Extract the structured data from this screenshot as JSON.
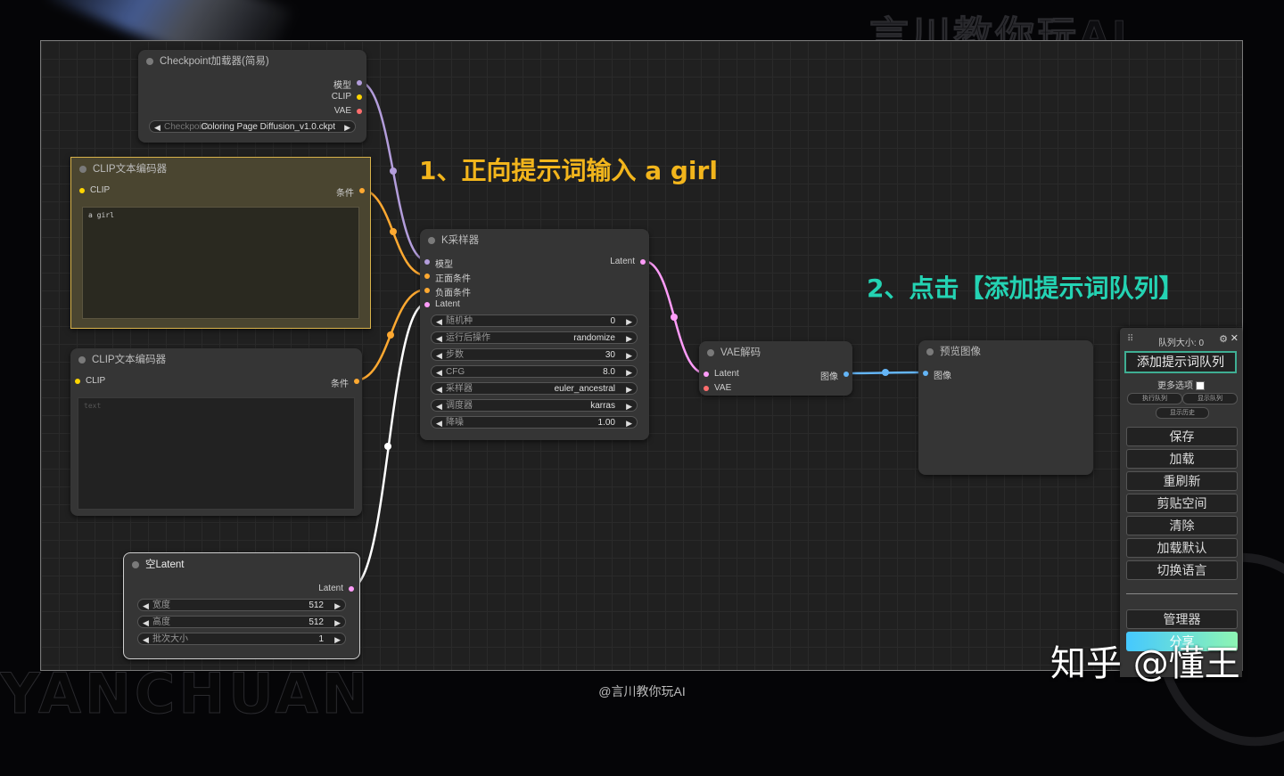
{
  "background": {
    "wordmark_top": "言川教你玩AI",
    "wordmark_bottom": "YANCHUAN"
  },
  "annotations": {
    "step1": "1、正向提示词输入 a girl",
    "step2": "2、点击【添加提示词队列】",
    "step1_color": "#f2b51c",
    "step2_color": "#24d3b3"
  },
  "nodes": {
    "checkpoint": {
      "title": "Checkpoint加载器(简易)",
      "outputs": [
        "模型",
        "CLIP",
        "VAE"
      ],
      "widget_label": "Checkpoint",
      "widget_value": "Coloring Page Diffusion_v1.0.ckpt"
    },
    "clip_positive": {
      "title": "CLIP文本编码器",
      "input": "CLIP",
      "output": "条件",
      "text": "a girl"
    },
    "clip_negative": {
      "title": "CLIP文本编码器",
      "input": "CLIP",
      "output": "条件",
      "text": "text"
    },
    "ksampler": {
      "title": "K采样器",
      "inputs": [
        "模型",
        "正面条件",
        "负面条件",
        "Latent"
      ],
      "output": "Latent",
      "widgets": [
        {
          "label": "随机种",
          "value": "0"
        },
        {
          "label": "运行后操作",
          "value": "randomize"
        },
        {
          "label": "步数",
          "value": "30"
        },
        {
          "label": "CFG",
          "value": "8.0"
        },
        {
          "label": "采样器",
          "value": "euler_ancestral"
        },
        {
          "label": "调度器",
          "value": "karras"
        },
        {
          "label": "降噪",
          "value": "1.00"
        }
      ]
    },
    "vae_decode": {
      "title": "VAE解码",
      "inputs": [
        "Latent",
        "VAE"
      ],
      "output": "图像"
    },
    "preview": {
      "title": "预览图像",
      "input": "图像"
    },
    "empty_latent": {
      "title": "空Latent",
      "output": "Latent",
      "widgets": [
        {
          "label": "宽度",
          "value": "512"
        },
        {
          "label": "高度",
          "value": "512"
        },
        {
          "label": "批次大小",
          "value": "1"
        }
      ]
    }
  },
  "menu": {
    "queue_size": "队列大小: 0",
    "queue_button": "添加提示词队列",
    "more_options": "更多选项",
    "small_buttons": [
      "执行队列",
      "显示队列",
      "显示历史"
    ],
    "buttons": [
      "保存",
      "加载",
      "重刷新",
      "剪贴空间",
      "清除",
      "加载默认",
      "切换语言"
    ],
    "manager": "管理器",
    "share": "分享"
  },
  "watermark": "知乎 @懂王",
  "credit": "@言川教你玩AI",
  "colors": {
    "model": "#b39ddb",
    "clip": "#ffd500",
    "vae": "#ff6e6e",
    "conditioning": "#ffa931",
    "latent": "#ff9cf9",
    "image": "#64b5f6"
  }
}
